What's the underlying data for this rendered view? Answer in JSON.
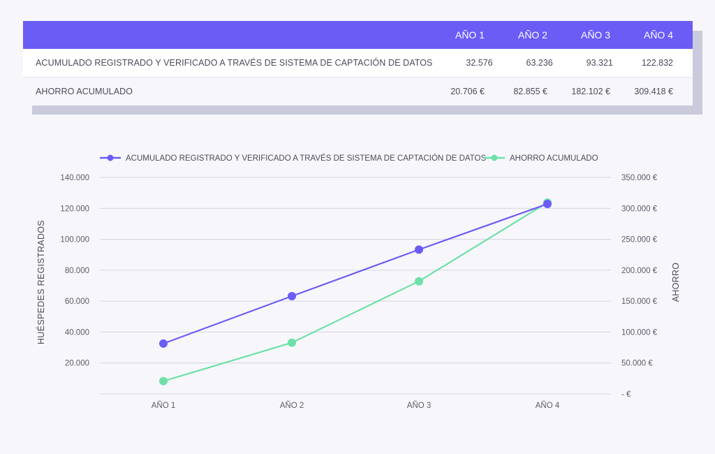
{
  "colors": {
    "header_bg": "#6b5cf6",
    "series_purple": "#6b5cf6",
    "series_green": "#6ee0a8",
    "grid": "#d4d4e2"
  },
  "table": {
    "headers": [
      "AÑO 1",
      "AÑO 2",
      "AÑO 3",
      "AÑO 4"
    ],
    "rows": [
      {
        "label": "ACUMULADO REGISTRADO Y VERIFICADO A TRAVÉS DE SISTEMA DE CAPTACIÓN DE DATOS",
        "values": [
          "32.576",
          "63.236",
          "93.321",
          "122.832"
        ]
      },
      {
        "label": "AHORRO ACUMULADO",
        "values": [
          "20.706 €",
          "82.855 €",
          "182.102 €",
          "309.418 €"
        ]
      }
    ]
  },
  "chart_data": {
    "type": "line",
    "categories": [
      "AÑO 1",
      "AÑO 2",
      "AÑO 3",
      "AÑO 4"
    ],
    "series": [
      {
        "name": "ACUMULADO REGISTRADO Y VERIFICADO A TRAVÉS DE SISTEMA DE CAPTACIÓN DE DATOS",
        "axis": "left",
        "color": "#6b5cf6",
        "values": [
          32576,
          63236,
          93321,
          122832
        ]
      },
      {
        "name": "AHORRO ACUMULADO",
        "axis": "right",
        "color": "#6ee0a8",
        "values": [
          20706,
          82855,
          182102,
          309418
        ]
      }
    ],
    "ylabel": "HUÉSPEDES REGISTRADOS",
    "ylabel_right": "AHORRO",
    "ylim": [
      0,
      140000
    ],
    "ylim_right": [
      0,
      350000
    ],
    "yticks_left": [
      "20.000",
      "40.000",
      "60.000",
      "80.000",
      "100.000",
      "120.000",
      "140.000"
    ],
    "yticks_left_values": [
      20000,
      40000,
      60000,
      80000,
      100000,
      120000,
      140000
    ],
    "yticks_right": [
      "- €",
      "50.000 €",
      "100.000 €",
      "150.000 €",
      "200.000 €",
      "250.000 €",
      "300.000 €",
      "350.000 €"
    ],
    "yticks_right_values": [
      0,
      50000,
      100000,
      150000,
      200000,
      250000,
      300000,
      350000
    ],
    "grid": true,
    "legend": "top"
  }
}
